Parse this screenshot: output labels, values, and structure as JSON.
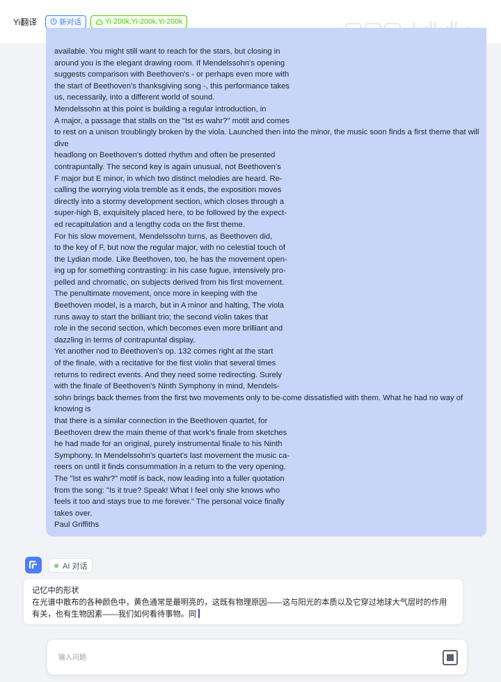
{
  "header": {
    "app_title": "Yi翻译",
    "new_chat_label": "新对话",
    "model_tag": "Yi-200k,Yi-200k,Yi-200k"
  },
  "watermark": {
    "text": "bilibili"
  },
  "document": {
    "lines": [
      "available. You might still want to reach for the stars, but closing in",
      "around you is the elegant drawing room. If Mendelssohn's opening",
      "suggests comparison with Beethoven's - or perhaps even more with",
      "the start of Beethoven's thanksgiving song -, this performance takes",
      "us, necessarily, into a different world of sound.",
      "Mendelssohn at this point is building a regular introduction, in",
      "A major, a passage that stalls on the \"Ist es wahr?\" motit and comes",
      "to rest on a unison troublingly broken by the viola. Launched then into the minor, the music soon finds a first theme that will dive",
      "headlong on Beethoven's dotted rhythm and often be presented",
      "contrapuntally. The second key is again unusual, not Beethoven's",
      "F major but E minor, in which two distinct melodies are heard. Re-",
      "calling the worrying viola tremble as it ends, the exposition moves",
      "directly into a stormy development section, which closes through a",
      "super-high B, exquisitely placed here, to be followed by the expect-",
      "ed recapitulation and a lengthy coda on the first theme.",
      "For his slow movement, Mendelssohn turns, as Beethoven did,",
      "to the key of F, but now the regular major, with no celestial touch of",
      "the Lydian mode. Like Beethoven, too, he has the movement open-",
      "ing up for something contrasting: in his case fugue, intensively pro-",
      "pelled and chromatic, on subjects derived from his first movement.",
      "The penultimate movement, once more in keeping with the",
      "Beethoven model, is a march, but in A minor and halting, The viola",
      "runs away to start the brilliant trio; the second violin takes that",
      "role in the second section, which becomes even more brilliant and",
      "dazzling in terms of contrapuntal display.",
      "Yet another nod to Beethoven's op. 132 comes right at the start",
      "of the finale, with a recitative for the first violin that several times",
      "returns to redirect events. And they need some redirecting. Surely",
      "with the finale of Beethoven's Ninth Symphony in mind, Mendels-",
      "sohn brings back themes from the first two movements only to be-come dissatisfied with them. What he had no way of knowing is",
      "that there is a similar connection in the Beethoven quartet, for",
      "Beethoven drew the main theme of that work's finale from sketches",
      "he had made for an original, purely instrumental finale to his Ninth",
      "Symphony. In Mendelssohn's quartet's last movement the music ca-",
      "reers on until it finds consummation in a return to the very opening.",
      "The \"Ist es wahr?\" motif is back, now leading into a fuller quotation",
      "from the song: \"Is it true? Speak! What I feel only she knows who",
      "feels it too and stays true to me forever.\" The personal voice finally",
      "takes over.",
      "Paul Griffiths"
    ]
  },
  "ai": {
    "badge_label": "AI 对话",
    "reply_title": "记忆中的形状",
    "reply_text": "在光谱中散布的各种颜色中，黄色通常是最明亮的，这既有物理原因——这与阳光的本质以及它穿过地球大气层时的作用有关，也有生物因素——我们如何看待事物。同"
  },
  "input": {
    "placeholder": "输入问题"
  },
  "colors": {
    "accent": "#3b82f6",
    "model_tag": "#52c41a",
    "document_bg": "#c6d5f8",
    "avatar": "#4d7cf5"
  }
}
